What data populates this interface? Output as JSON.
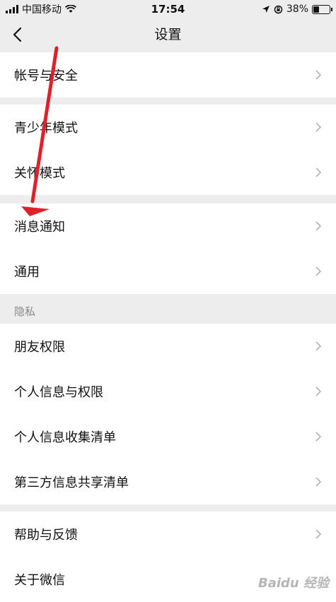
{
  "status": {
    "carrier": "中国移动",
    "time": "17:54",
    "battery": "38%",
    "battery_level": 0.38
  },
  "nav": {
    "title": "设置"
  },
  "groups": [
    {
      "items": [
        {
          "label": "帐号与安全"
        }
      ]
    },
    {
      "items": [
        {
          "label": "青少年模式"
        },
        {
          "label": "关怀模式"
        }
      ]
    },
    {
      "items": [
        {
          "label": "消息通知"
        },
        {
          "label": "通用"
        }
      ]
    },
    {
      "header": "隐私",
      "items": [
        {
          "label": "朋友权限"
        },
        {
          "label": "个人信息与权限"
        },
        {
          "label": "个人信息收集清单"
        },
        {
          "label": "第三方信息共享清单"
        }
      ]
    },
    {
      "items": [
        {
          "label": "帮助与反馈"
        },
        {
          "label": "关于微信"
        }
      ]
    }
  ],
  "watermark": "Baidu 经验",
  "colors": {
    "annotation_arrow": "#e0202a",
    "background": "#ededed",
    "row": "#ffffff"
  }
}
